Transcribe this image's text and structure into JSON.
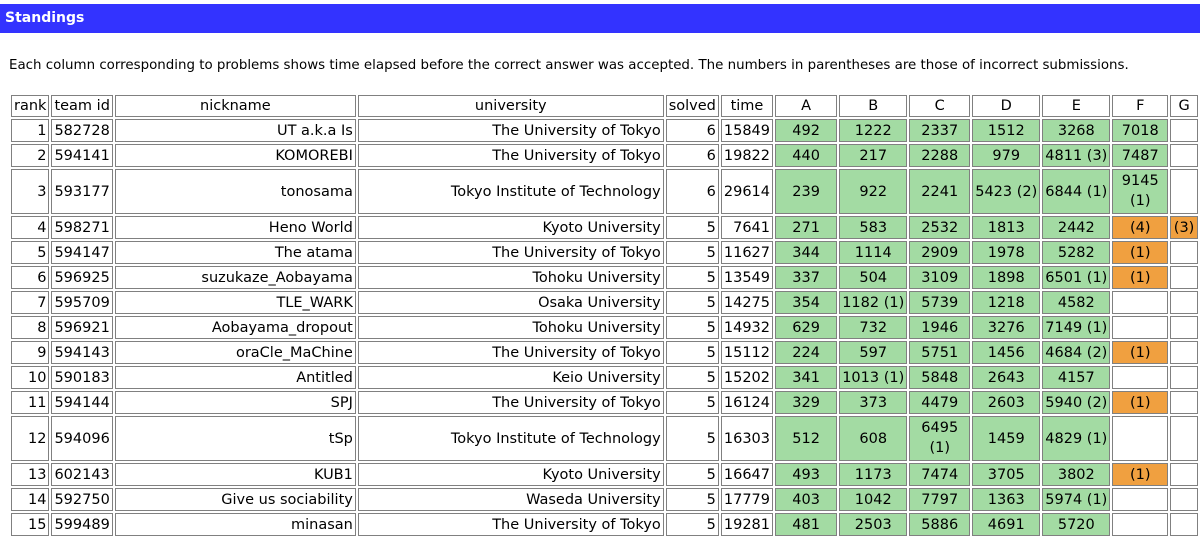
{
  "page": {
    "title": "Standings",
    "description": "Each column corresponding to problems shows time elapsed before the correct answer was accepted. The numbers in parentheses are those of incorrect submissions."
  },
  "colors": {
    "header_bar": "#3333ff",
    "accepted": "#a3dba3",
    "failed": "#f0a040"
  },
  "table": {
    "headers": [
      "rank",
      "team id",
      "nickname",
      "university",
      "solved",
      "time",
      "A",
      "B",
      "C",
      "D",
      "E",
      "F",
      "G"
    ],
    "rows": [
      {
        "rank": "1",
        "team_id": "582728",
        "nickname": "UT a.k.a Is",
        "university": "The University of Tokyo",
        "solved": "6",
        "time": "15849",
        "problems": [
          {
            "text": "492",
            "status": "accepted"
          },
          {
            "text": "1222",
            "status": "accepted"
          },
          {
            "text": "2337",
            "status": "accepted"
          },
          {
            "text": "1512",
            "status": "accepted"
          },
          {
            "text": "3268",
            "status": "accepted"
          },
          {
            "text": "7018",
            "status": "accepted"
          },
          {
            "text": "",
            "status": "none"
          }
        ]
      },
      {
        "rank": "2",
        "team_id": "594141",
        "nickname": "KOMOREBI",
        "university": "The University of Tokyo",
        "solved": "6",
        "time": "19822",
        "problems": [
          {
            "text": "440",
            "status": "accepted"
          },
          {
            "text": "217",
            "status": "accepted"
          },
          {
            "text": "2288",
            "status": "accepted"
          },
          {
            "text": "979",
            "status": "accepted"
          },
          {
            "text": "4811 (3)",
            "status": "accepted"
          },
          {
            "text": "7487",
            "status": "accepted"
          },
          {
            "text": "",
            "status": "none"
          }
        ]
      },
      {
        "rank": "3",
        "team_id": "593177",
        "nickname": "tonosama",
        "university": "Tokyo Institute of Technology",
        "solved": "6",
        "time": "29614",
        "tall": true,
        "problems": [
          {
            "text": "239",
            "status": "accepted"
          },
          {
            "text": "922",
            "status": "accepted"
          },
          {
            "text": "2241",
            "status": "accepted"
          },
          {
            "text": "5423 (2)",
            "status": "accepted"
          },
          {
            "text": "6844 (1)",
            "status": "accepted"
          },
          {
            "text": "9145 (1)",
            "status": "accepted",
            "wrap": true
          },
          {
            "text": "",
            "status": "none"
          }
        ]
      },
      {
        "rank": "4",
        "team_id": "598271",
        "nickname": "Heno World",
        "university": "Kyoto University",
        "solved": "5",
        "time": "7641",
        "problems": [
          {
            "text": "271",
            "status": "accepted"
          },
          {
            "text": "583",
            "status": "accepted"
          },
          {
            "text": "2532",
            "status": "accepted"
          },
          {
            "text": "1813",
            "status": "accepted"
          },
          {
            "text": "2442",
            "status": "accepted"
          },
          {
            "text": "(4)",
            "status": "failed"
          },
          {
            "text": "(3)",
            "status": "failed"
          }
        ]
      },
      {
        "rank": "5",
        "team_id": "594147",
        "nickname": "The atama",
        "university": "The University of Tokyo",
        "solved": "5",
        "time": "11627",
        "problems": [
          {
            "text": "344",
            "status": "accepted"
          },
          {
            "text": "1114",
            "status": "accepted"
          },
          {
            "text": "2909",
            "status": "accepted"
          },
          {
            "text": "1978",
            "status": "accepted"
          },
          {
            "text": "5282",
            "status": "accepted"
          },
          {
            "text": "(1)",
            "status": "failed"
          },
          {
            "text": "",
            "status": "none"
          }
        ]
      },
      {
        "rank": "6",
        "team_id": "596925",
        "nickname": "suzukaze_Aobayama",
        "university": "Tohoku University",
        "solved": "5",
        "time": "13549",
        "problems": [
          {
            "text": "337",
            "status": "accepted"
          },
          {
            "text": "504",
            "status": "accepted"
          },
          {
            "text": "3109",
            "status": "accepted"
          },
          {
            "text": "1898",
            "status": "accepted"
          },
          {
            "text": "6501 (1)",
            "status": "accepted"
          },
          {
            "text": "(1)",
            "status": "failed"
          },
          {
            "text": "",
            "status": "none"
          }
        ]
      },
      {
        "rank": "7",
        "team_id": "595709",
        "nickname": "TLE_WARK",
        "university": "Osaka University",
        "solved": "5",
        "time": "14275",
        "problems": [
          {
            "text": "354",
            "status": "accepted"
          },
          {
            "text": "1182 (1)",
            "status": "accepted"
          },
          {
            "text": "5739",
            "status": "accepted"
          },
          {
            "text": "1218",
            "status": "accepted"
          },
          {
            "text": "4582",
            "status": "accepted"
          },
          {
            "text": "",
            "status": "none"
          },
          {
            "text": "",
            "status": "none"
          }
        ]
      },
      {
        "rank": "8",
        "team_id": "596921",
        "nickname": "Aobayama_dropout",
        "university": "Tohoku University",
        "solved": "5",
        "time": "14932",
        "problems": [
          {
            "text": "629",
            "status": "accepted"
          },
          {
            "text": "732",
            "status": "accepted"
          },
          {
            "text": "1946",
            "status": "accepted"
          },
          {
            "text": "3276",
            "status": "accepted"
          },
          {
            "text": "7149 (1)",
            "status": "accepted"
          },
          {
            "text": "",
            "status": "none"
          },
          {
            "text": "",
            "status": "none"
          }
        ]
      },
      {
        "rank": "9",
        "team_id": "594143",
        "nickname": "oraCle_MaChine",
        "university": "The University of Tokyo",
        "solved": "5",
        "time": "15112",
        "problems": [
          {
            "text": "224",
            "status": "accepted"
          },
          {
            "text": "597",
            "status": "accepted"
          },
          {
            "text": "5751",
            "status": "accepted"
          },
          {
            "text": "1456",
            "status": "accepted"
          },
          {
            "text": "4684 (2)",
            "status": "accepted"
          },
          {
            "text": "(1)",
            "status": "failed"
          },
          {
            "text": "",
            "status": "none"
          }
        ]
      },
      {
        "rank": "10",
        "team_id": "590183",
        "nickname": "Antitled",
        "university": "Keio University",
        "solved": "5",
        "time": "15202",
        "problems": [
          {
            "text": "341",
            "status": "accepted"
          },
          {
            "text": "1013 (1)",
            "status": "accepted"
          },
          {
            "text": "5848",
            "status": "accepted"
          },
          {
            "text": "2643",
            "status": "accepted"
          },
          {
            "text": "4157",
            "status": "accepted"
          },
          {
            "text": "",
            "status": "none"
          },
          {
            "text": "",
            "status": "none"
          }
        ]
      },
      {
        "rank": "11",
        "team_id": "594144",
        "nickname": "SPJ",
        "university": "The University of Tokyo",
        "solved": "5",
        "time": "16124",
        "problems": [
          {
            "text": "329",
            "status": "accepted"
          },
          {
            "text": "373",
            "status": "accepted"
          },
          {
            "text": "4479",
            "status": "accepted"
          },
          {
            "text": "2603",
            "status": "accepted"
          },
          {
            "text": "5940 (2)",
            "status": "accepted"
          },
          {
            "text": "(1)",
            "status": "failed"
          },
          {
            "text": "",
            "status": "none"
          }
        ]
      },
      {
        "rank": "12",
        "team_id": "594096",
        "nickname": "tSp",
        "university": "Tokyo Institute of Technology",
        "solved": "5",
        "time": "16303",
        "tall": true,
        "problems": [
          {
            "text": "512",
            "status": "accepted"
          },
          {
            "text": "608",
            "status": "accepted"
          },
          {
            "text": "6495 (1)",
            "status": "accepted",
            "wrap": true
          },
          {
            "text": "1459",
            "status": "accepted"
          },
          {
            "text": "4829 (1)",
            "status": "accepted"
          },
          {
            "text": "",
            "status": "none"
          },
          {
            "text": "",
            "status": "none"
          }
        ]
      },
      {
        "rank": "13",
        "team_id": "602143",
        "nickname": "KUB1",
        "university": "Kyoto University",
        "solved": "5",
        "time": "16647",
        "problems": [
          {
            "text": "493",
            "status": "accepted"
          },
          {
            "text": "1173",
            "status": "accepted"
          },
          {
            "text": "7474",
            "status": "accepted"
          },
          {
            "text": "3705",
            "status": "accepted"
          },
          {
            "text": "3802",
            "status": "accepted"
          },
          {
            "text": "(1)",
            "status": "failed"
          },
          {
            "text": "",
            "status": "none"
          }
        ]
      },
      {
        "rank": "14",
        "team_id": "592750",
        "nickname": "Give us sociability",
        "university": "Waseda University",
        "solved": "5",
        "time": "17779",
        "problems": [
          {
            "text": "403",
            "status": "accepted"
          },
          {
            "text": "1042",
            "status": "accepted"
          },
          {
            "text": "7797",
            "status": "accepted"
          },
          {
            "text": "1363",
            "status": "accepted"
          },
          {
            "text": "5974 (1)",
            "status": "accepted"
          },
          {
            "text": "",
            "status": "none"
          },
          {
            "text": "",
            "status": "none"
          }
        ]
      },
      {
        "rank": "15",
        "team_id": "599489",
        "nickname": "minasan",
        "university": "The University of Tokyo",
        "solved": "5",
        "time": "19281",
        "problems": [
          {
            "text": "481",
            "status": "accepted"
          },
          {
            "text": "2503",
            "status": "accepted"
          },
          {
            "text": "5886",
            "status": "accepted"
          },
          {
            "text": "4691",
            "status": "accepted"
          },
          {
            "text": "5720",
            "status": "accepted"
          },
          {
            "text": "",
            "status": "none"
          },
          {
            "text": "",
            "status": "none"
          }
        ]
      }
    ]
  }
}
